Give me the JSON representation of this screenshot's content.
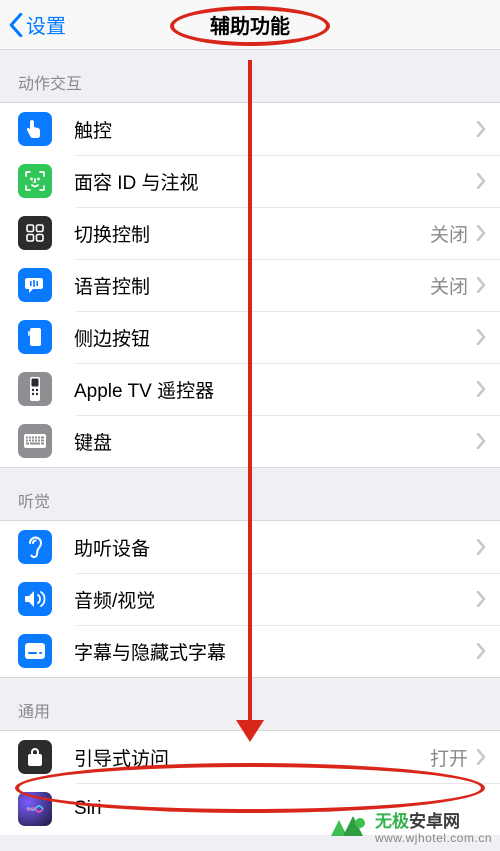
{
  "nav": {
    "back_label": "设置",
    "title": "辅助功能"
  },
  "sections": {
    "motion": {
      "header": "动作交互"
    },
    "hearing": {
      "header": "听觉"
    },
    "general": {
      "header": "通用"
    }
  },
  "rows": {
    "touch": {
      "label": "触控"
    },
    "faceid": {
      "label": "面容 ID 与注视"
    },
    "switch_control": {
      "label": "切换控制",
      "status": "关闭"
    },
    "voice_control": {
      "label": "语音控制",
      "status": "关闭"
    },
    "side_button": {
      "label": "侧边按钮"
    },
    "apple_tv_remote": {
      "label": "Apple TV 遥控器"
    },
    "keyboard": {
      "label": "键盘"
    },
    "hearing_devices": {
      "label": "助听设备"
    },
    "audio_visual": {
      "label": "音频/视觉"
    },
    "subtitles": {
      "label": "字幕与隐藏式字幕"
    },
    "guided_access": {
      "label": "引导式访问",
      "status": "打开"
    },
    "siri": {
      "label": "Siri"
    }
  },
  "watermark": {
    "brand_cn": "无极安卓网",
    "brand_green": "无极",
    "brand_rest": "安卓网",
    "url": "www.wjhotel.com.cn"
  }
}
